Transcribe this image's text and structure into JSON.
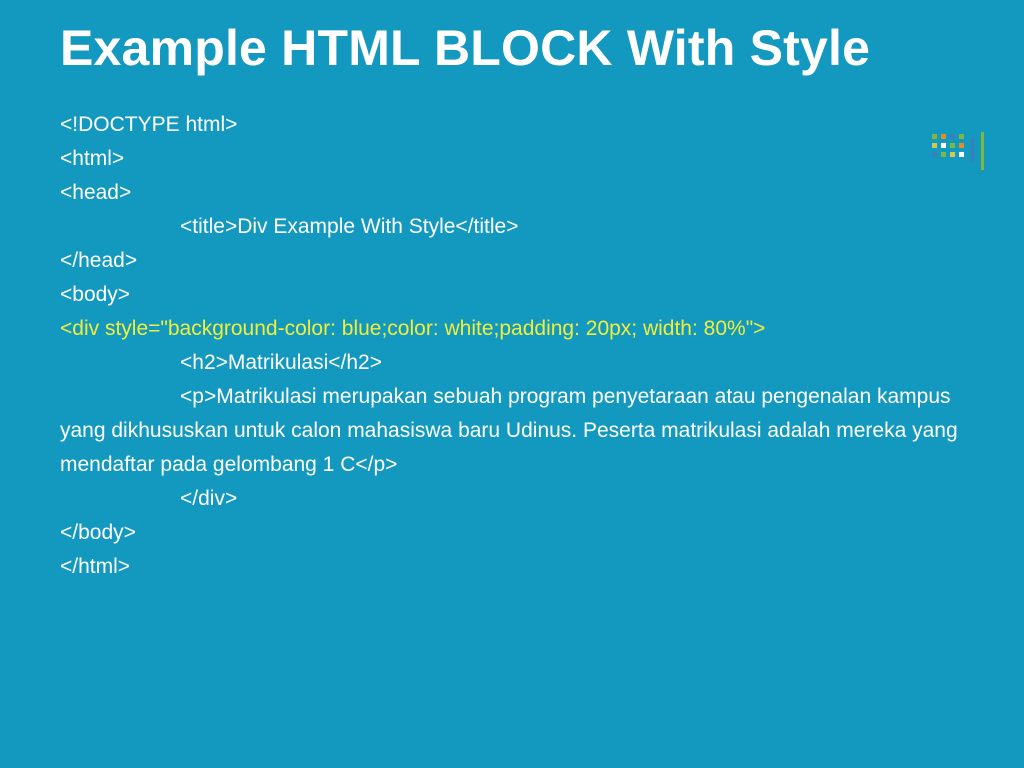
{
  "slide": {
    "title": "Example HTML BLOCK With Style",
    "code": {
      "l1": "<!DOCTYPE html>",
      "l2": "<html>",
      "l3": "<head>",
      "l4": "<title>Div Example With Style</title>",
      "l5": "</head>",
      "l6": "<body>",
      "l7": "<div style=\"background-color: blue;color: white;padding: 20px; width: 80%\">",
      "l8": "<h2>Matrikulasi</h2>",
      "l9": "<p>Matrikulasi merupakan sebuah program penyetaraan atau pengenalan kampus yang dikhususkan untuk calon mahasiswa baru Udinus. Peserta matrikulasi adalah mereka yang mendaftar pada gelombang 1 C</p>",
      "l10": "</div>",
      "l11": "</body>",
      "l12": "</html>"
    }
  }
}
